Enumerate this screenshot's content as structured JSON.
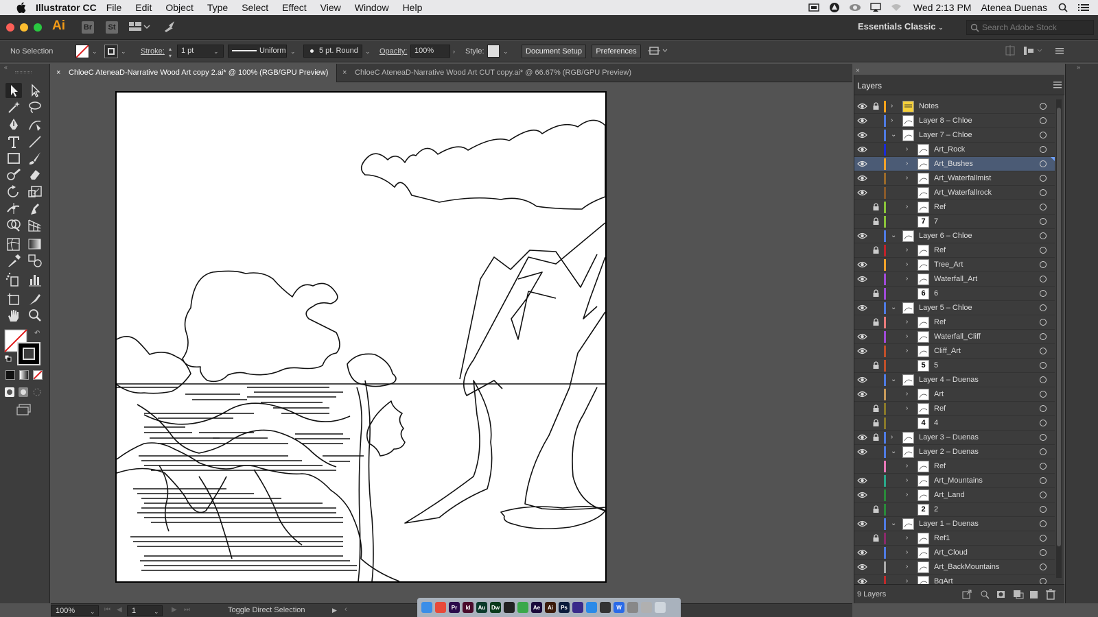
{
  "menubar": {
    "app_name": "Illustrator CC",
    "items": [
      "File",
      "Edit",
      "Object",
      "Type",
      "Select",
      "Effect",
      "View",
      "Window",
      "Help"
    ],
    "clock": "Wed 2:13 PM",
    "user": "Atenea Duenas"
  },
  "appbar": {
    "logo": "Ai",
    "bridge": "Br",
    "stock_btn": "St",
    "workspace": "Essentials Classic",
    "search_placeholder": "Search Adobe Stock"
  },
  "control": {
    "selection": "No Selection",
    "stroke_label": "Stroke:",
    "stroke_value": "1 pt",
    "profile": "Uniform",
    "brush": "5 pt. Round",
    "opacity_label": "Opacity:",
    "opacity_value": "100%",
    "style_label": "Style:",
    "doc_setup": "Document Setup",
    "preferences": "Preferences"
  },
  "tabs": [
    {
      "label": "ChloeC AteneaD-Narrative Wood Art copy 2.ai* @ 100% (RGB/GPU Preview)",
      "active": true
    },
    {
      "label": "ChloeC AteneaD-Narrative Wood Art CUT copy.ai* @ 66.67% (RGB/GPU Preview)",
      "active": false
    }
  ],
  "status": {
    "zoom": "100%",
    "page": "1",
    "message": "Toggle Direct Selection"
  },
  "layers_panel": {
    "title": "Layers",
    "count": "9 Layers",
    "rows": [
      {
        "name": "Notes",
        "level": 0,
        "eye": true,
        "lock": true,
        "color": "#f7a21b",
        "expanded": false,
        "thumb": "note"
      },
      {
        "name": "Layer 8 – Chloe",
        "level": 0,
        "eye": true,
        "lock": false,
        "color": "#4f7be3",
        "expanded": false,
        "thumb": ""
      },
      {
        "name": "Layer 7 – Chloe",
        "level": 0,
        "eye": true,
        "lock": false,
        "color": "#4f7be3",
        "expanded": true,
        "thumb": ""
      },
      {
        "name": "Art_Rock",
        "level": 1,
        "eye": true,
        "lock": false,
        "color": "#1a2bd8",
        "expanded": false,
        "thumb": ""
      },
      {
        "name": "Art_Bushes",
        "level": 1,
        "eye": true,
        "lock": false,
        "color": "#f0a22a",
        "expanded": false,
        "thumb": "",
        "selected": true
      },
      {
        "name": "Art_Waterfallmist",
        "level": 1,
        "eye": true,
        "lock": false,
        "color": "#9a6a2a",
        "expanded": false,
        "thumb": ""
      },
      {
        "name": "Art_Waterfallrock",
        "level": 1,
        "eye": true,
        "lock": false,
        "color": "#8a5a2a",
        "noarrow": true,
        "thumb": ""
      },
      {
        "name": "Ref",
        "level": 1,
        "eye": false,
        "lock": true,
        "color": "#8ac43a",
        "expanded": false,
        "thumb": ""
      },
      {
        "name": "7",
        "level": 1,
        "eye": false,
        "lock": true,
        "color": "#8ac43a",
        "noarrow": true,
        "thumb": "7"
      },
      {
        "name": "Layer 6 – Chloe",
        "level": 0,
        "eye": true,
        "lock": false,
        "color": "#4f7be3",
        "expanded": true,
        "thumb": ""
      },
      {
        "name": "Ref",
        "level": 1,
        "eye": false,
        "lock": true,
        "color": "#c0222a",
        "expanded": false,
        "thumb": ""
      },
      {
        "name": "Tree_Art",
        "level": 1,
        "eye": true,
        "lock": false,
        "color": "#f0a22a",
        "expanded": false,
        "thumb": ""
      },
      {
        "name": "Waterfall_Art",
        "level": 1,
        "eye": true,
        "lock": false,
        "color": "#a04ad8",
        "expanded": false,
        "thumb": ""
      },
      {
        "name": "6",
        "level": 1,
        "eye": false,
        "lock": true,
        "color": "#a04ad8",
        "noarrow": true,
        "thumb": "6"
      },
      {
        "name": "Layer 5 – Chloe",
        "level": 0,
        "eye": true,
        "lock": false,
        "color": "#4f7be3",
        "expanded": true,
        "thumb": ""
      },
      {
        "name": "Ref",
        "level": 1,
        "eye": false,
        "lock": true,
        "color": "#e87a7a",
        "expanded": false,
        "thumb": ""
      },
      {
        "name": "Waterfall_Cliff",
        "level": 1,
        "eye": true,
        "lock": false,
        "color": "#a04ad8",
        "expanded": false,
        "thumb": ""
      },
      {
        "name": "Cliff_Art",
        "level": 1,
        "eye": true,
        "lock": false,
        "color": "#c0502a",
        "expanded": false,
        "thumb": ""
      },
      {
        "name": "5",
        "level": 1,
        "eye": false,
        "lock": true,
        "color": "#c0502a",
        "noarrow": true,
        "thumb": "5"
      },
      {
        "name": "Layer 4 – Duenas",
        "level": 0,
        "eye": true,
        "lock": false,
        "color": "#4f7be3",
        "expanded": true,
        "thumb": ""
      },
      {
        "name": "Art",
        "level": 1,
        "eye": true,
        "lock": false,
        "color": "#c89a5a",
        "expanded": false,
        "thumb": ""
      },
      {
        "name": "Ref",
        "level": 1,
        "eye": false,
        "lock": true,
        "color": "#8a7a2a",
        "expanded": false,
        "thumb": ""
      },
      {
        "name": "4",
        "level": 1,
        "eye": false,
        "lock": true,
        "color": "#8a7a2a",
        "noarrow": true,
        "thumb": "4"
      },
      {
        "name": "Layer 3 – Duenas",
        "level": 0,
        "eye": true,
        "lock": true,
        "color": "#4f7be3",
        "expanded": false,
        "thumb": ""
      },
      {
        "name": "Layer 2 – Duenas",
        "level": 0,
        "eye": true,
        "lock": false,
        "color": "#4f7be3",
        "expanded": true,
        "thumb": ""
      },
      {
        "name": "Ref",
        "level": 1,
        "eye": false,
        "lock": false,
        "color": "#e878b8",
        "expanded": false,
        "thumb": ""
      },
      {
        "name": "Art_Mountains",
        "level": 1,
        "eye": true,
        "lock": false,
        "color": "#2aa88a",
        "expanded": false,
        "thumb": ""
      },
      {
        "name": "Art_Land",
        "level": 1,
        "eye": true,
        "lock": false,
        "color": "#2a8a3a",
        "expanded": false,
        "thumb": ""
      },
      {
        "name": "2",
        "level": 1,
        "eye": false,
        "lock": true,
        "color": "#2a8a3a",
        "noarrow": true,
        "thumb": "2"
      },
      {
        "name": "Layer 1 – Duenas",
        "level": 0,
        "eye": true,
        "lock": false,
        "color": "#4f7be3",
        "expanded": true,
        "thumb": ""
      },
      {
        "name": "Ref1",
        "level": 1,
        "eye": false,
        "lock": true,
        "color": "#8a2a6a",
        "expanded": false,
        "thumb": ""
      },
      {
        "name": "Art_Cloud",
        "level": 1,
        "eye": true,
        "lock": false,
        "color": "#4f7be3",
        "expanded": false,
        "thumb": ""
      },
      {
        "name": "Art_BackMountains",
        "level": 1,
        "eye": true,
        "lock": false,
        "color": "#aaaaaa",
        "expanded": false,
        "thumb": ""
      },
      {
        "name": "BgArt",
        "level": 1,
        "eye": true,
        "lock": false,
        "color": "#c02a2a",
        "expanded": false,
        "thumb": ""
      }
    ]
  },
  "dock_apps": [
    {
      "label": "",
      "color": "#3a8ee8"
    },
    {
      "label": "",
      "color": "#e84a3a"
    },
    {
      "label": "Pr",
      "color": "#2a0a4a"
    },
    {
      "label": "Id",
      "color": "#4a0a2a"
    },
    {
      "label": "Au",
      "color": "#0a3a2a"
    },
    {
      "label": "Dw",
      "color": "#0a3a1a"
    },
    {
      "label": "",
      "color": "#222222"
    },
    {
      "label": "",
      "color": "#3aa84a"
    },
    {
      "label": "Ae",
      "color": "#1a0a3a"
    },
    {
      "label": "Ai",
      "color": "#3a1a0a"
    },
    {
      "label": "Ps",
      "color": "#0a1a3a"
    },
    {
      "label": "",
      "color": "#3a2a8a"
    },
    {
      "label": "",
      "color": "#2a8ae8"
    },
    {
      "label": "",
      "color": "#333333"
    },
    {
      "label": "W",
      "color": "#2a6ae8"
    },
    {
      "label": "",
      "color": "#888888"
    },
    {
      "label": "",
      "color": "#b0b0b0"
    },
    {
      "label": "",
      "color": "#cfd6dd"
    }
  ]
}
